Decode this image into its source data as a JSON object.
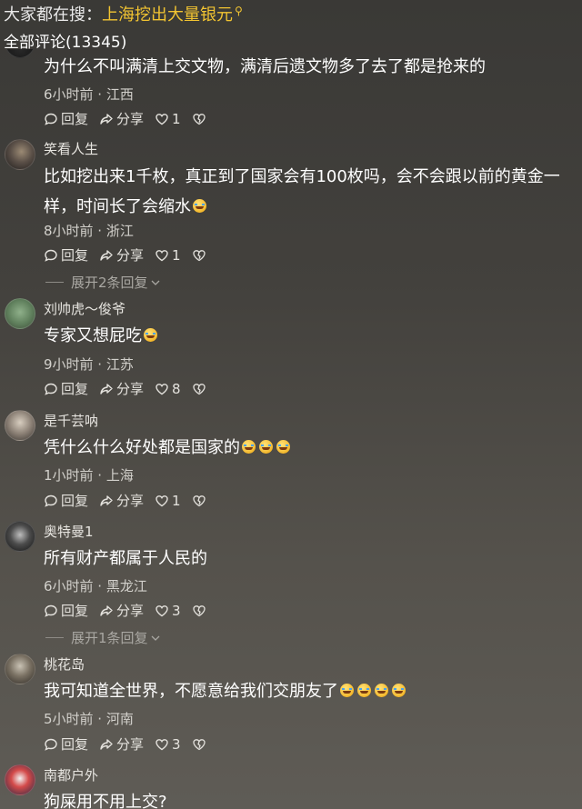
{
  "header": {
    "label": "大家都在搜：",
    "search_term": "上海挖出大量银元",
    "search_icon": "search-icon"
  },
  "comments_count": "全部评论(13345)",
  "actions": {
    "reply": "回复",
    "share": "分享"
  },
  "comments": [
    {
      "username": "",
      "text": "为什么不叫满清上交文物，满清后遗文物多了去了都是抢来的",
      "emoji_count": 0,
      "meta": "6小时前 · 江西",
      "likes": "1",
      "expand": ""
    },
    {
      "username": "笑看人生",
      "text": "比如挖出来1千枚，真正到了国家会有100枚吗，会不会跟以前的黄金一样，时间长了会缩水",
      "emoji_count": 1,
      "meta": "8小时前 · 浙江",
      "likes": "1",
      "expand": "展开2条回复"
    },
    {
      "username": "刘帅虎～俊爷",
      "text": "专家又想屁吃",
      "emoji_count": 1,
      "meta": "9小时前 · 江苏",
      "likes": "8",
      "expand": ""
    },
    {
      "username": "是千芸呐",
      "text": "凭什么什么好处都是国家的",
      "emoji_count": 3,
      "meta": "1小时前 · 上海",
      "likes": "1",
      "expand": ""
    },
    {
      "username": "奥特曼1",
      "text": "所有财产都属于人民的",
      "emoji_count": 0,
      "meta": "6小时前 · 黑龙江",
      "likes": "3",
      "expand": "展开1条回复"
    },
    {
      "username": "桃花岛",
      "text": "我可知道全世界，不愿意给我们交朋友了",
      "emoji_count": 4,
      "meta": "5小时前 · 河南",
      "likes": "3",
      "expand": ""
    },
    {
      "username": "南都户外",
      "text": "狗屎用不用上交?",
      "emoji_count": 0,
      "meta": "",
      "likes": "",
      "expand": ""
    }
  ]
}
